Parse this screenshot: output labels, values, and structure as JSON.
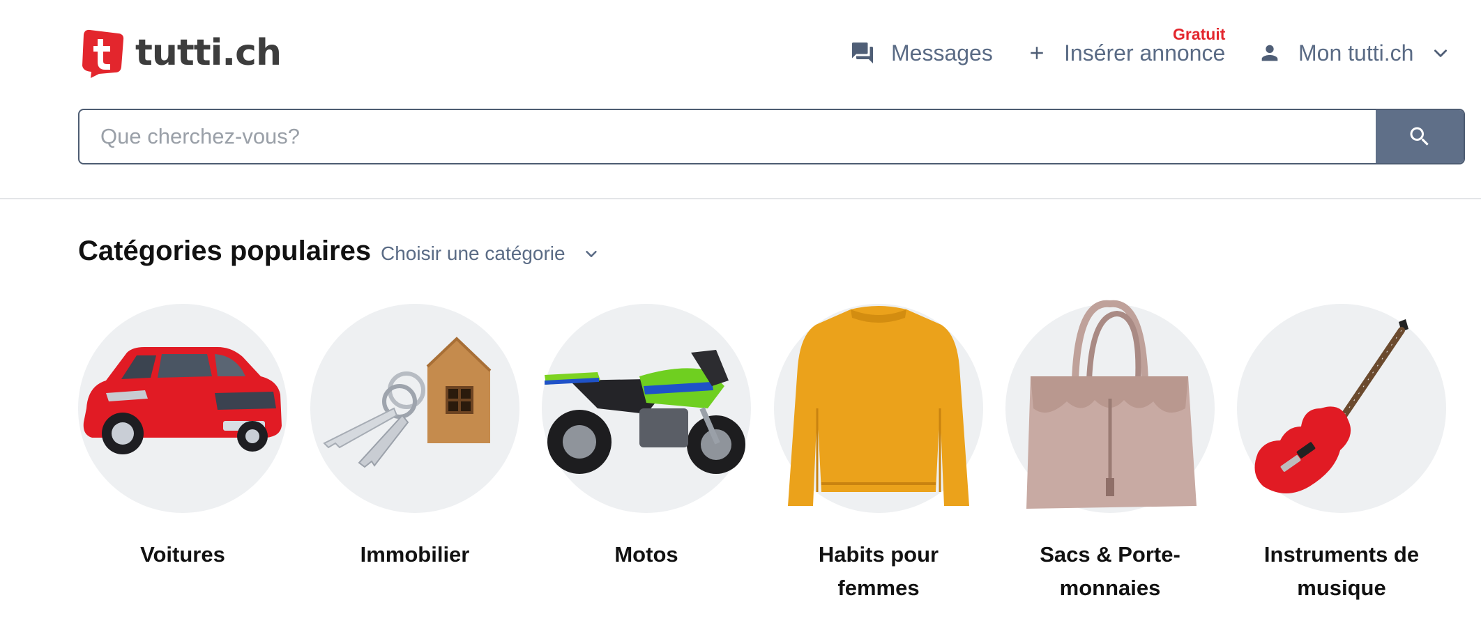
{
  "header": {
    "logo_text": "tutti.ch",
    "nav": {
      "messages_label": "Messages",
      "insert_label": "Insérer annonce",
      "insert_badge": "Gratuit",
      "account_label": "Mon tutti.ch"
    },
    "icons": {
      "messages": "chat-bubbles-icon",
      "insert": "plus-icon",
      "account": "user-icon",
      "account_menu": "chevron-down-icon",
      "search": "search-icon"
    }
  },
  "search": {
    "placeholder": "Que cherchez-vous?",
    "value": ""
  },
  "categories": {
    "title": "Catégories populaires",
    "select_label": "Choisir une catégorie",
    "items": [
      {
        "label": "Voitures",
        "image": "red-car"
      },
      {
        "label": "Immobilier",
        "image": "keys-with-house-keychain"
      },
      {
        "label": "Motos",
        "image": "green-motorcycle"
      },
      {
        "label": "Habits pour femmes",
        "image": "yellow-sweater"
      },
      {
        "label": "Sacs & Porte-monnaies",
        "image": "taupe-handbag"
      },
      {
        "label": "Instruments de musique",
        "image": "red-electric-guitar"
      }
    ]
  },
  "colors": {
    "brand_red": "#e3262d",
    "nav_text": "#5a6b85",
    "search_button": "#5f6f88",
    "circle_bg": "#eef0f2"
  }
}
